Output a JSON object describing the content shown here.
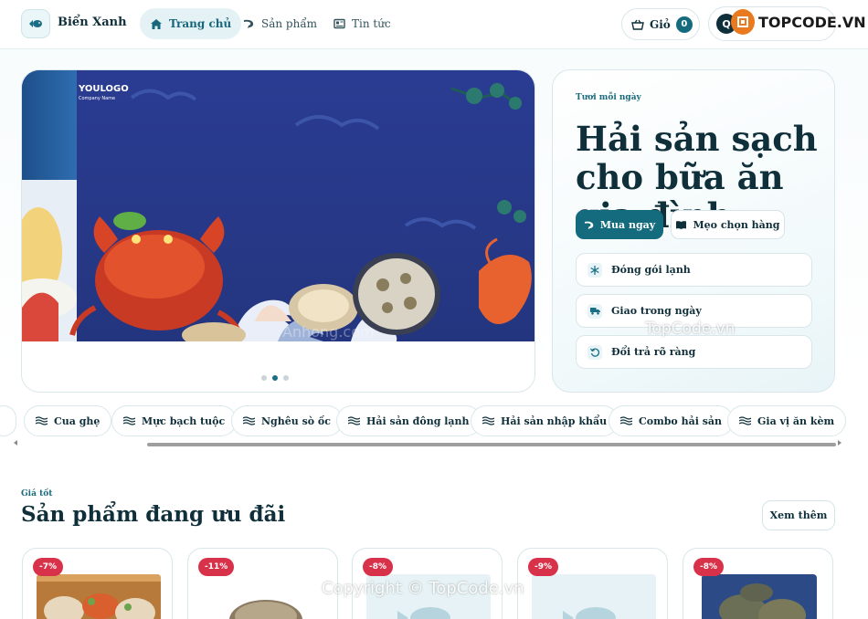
{
  "header": {
    "brand": "Biển Xanh",
    "nav": [
      {
        "label": "Trang chủ",
        "icon": "home-icon",
        "active": true
      },
      {
        "label": "Sản phẩm",
        "icon": "shrimp-icon",
        "active": false
      },
      {
        "label": "Tin tức",
        "icon": "news-icon",
        "active": false
      }
    ],
    "cart_label": "Giỏ",
    "cart_count": "0",
    "account_initial": "Q",
    "watermark_logo": "TOPCODE.VN"
  },
  "hero": {
    "banner_logo": "YOULOGO",
    "banner_company": "Company Name",
    "banner_watermark": "Anhong.com",
    "slide_count": 3,
    "active_slide": 2,
    "eyebrow": "Tươi mỗi ngày",
    "title": "Hải sản sạch cho bữa ăn gia đình",
    "buy_button": "Mua ngay",
    "tips_button": "Mẹo chọn hàng",
    "features": [
      {
        "label": "Đóng gói lạnh",
        "icon": "snowflake-icon"
      },
      {
        "label": "Giao trong ngày",
        "icon": "truck-icon"
      },
      {
        "label": "Đổi trả rõ ràng",
        "icon": "return-icon"
      }
    ],
    "watermark": "TopCode.vn"
  },
  "categories": [
    "Cua ghẹ",
    "Mực bạch tuộc",
    "Nghêu sò ốc",
    "Hải sản đông lạnh",
    "Hải sản nhập khẩu",
    "Combo hải sản",
    "Gia vị ăn kèm"
  ],
  "deals": {
    "eyebrow": "Giá tốt",
    "title": "Sản phẩm đang ưu đãi",
    "see_more": "Xem thêm",
    "products": [
      {
        "discount": "-7%",
        "image": "seafood-platter"
      },
      {
        "discount": "-11%",
        "image": "oyster"
      },
      {
        "discount": "-8%",
        "image": "fish-placeholder"
      },
      {
        "discount": "-9%",
        "image": "fish-placeholder"
      },
      {
        "discount": "-8%",
        "image": "crabs"
      }
    ]
  },
  "footer_watermark": "Copyright © TopCode.vn",
  "colors": {
    "primary": "#136b7d",
    "text": "#0f2f3a",
    "discount": "#d8324a",
    "banner_blue": "#2d3f96"
  }
}
